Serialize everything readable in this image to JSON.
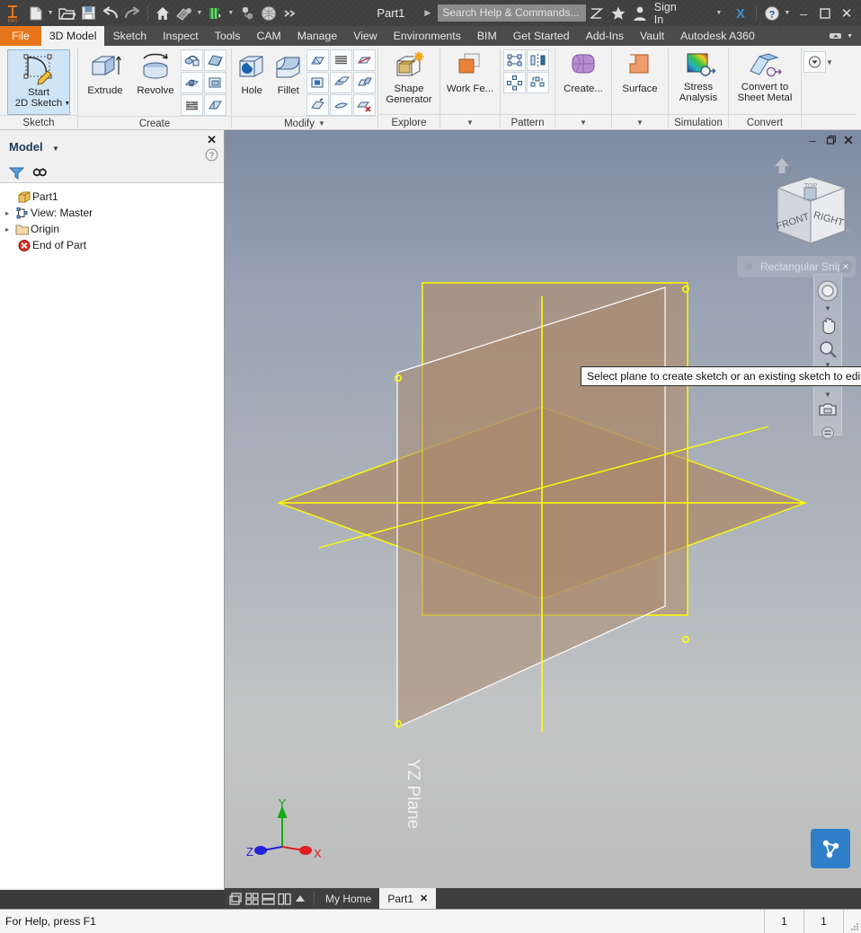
{
  "app": {
    "document_title": "Part1",
    "logo_text": "PRO"
  },
  "quick_access": {
    "items": [
      {
        "name": "new-file-icon",
        "label": "New"
      },
      {
        "name": "open-file-icon",
        "label": "Open"
      },
      {
        "name": "save-icon",
        "label": "Save"
      },
      {
        "name": "undo-icon",
        "label": "Undo"
      },
      {
        "name": "redo-icon",
        "label": "Redo"
      },
      {
        "name": "home-icon",
        "label": "Home"
      },
      {
        "name": "appearance-icon",
        "label": "Appearance"
      },
      {
        "name": "material-icon",
        "label": "Material"
      },
      {
        "name": "select-icon",
        "label": "Select"
      },
      {
        "name": "project-icon",
        "label": "Project"
      },
      {
        "name": "more-icon",
        "label": "More"
      }
    ]
  },
  "search": {
    "placeholder": "Search Help & Commands...",
    "value": ""
  },
  "account": {
    "sign_in_label": "Sign In"
  },
  "window_controls": {
    "minimize": "–",
    "maximize": "❐",
    "close": "✕"
  },
  "menu_tabs": [
    {
      "label": "File",
      "state": "file"
    },
    {
      "label": "3D Model",
      "state": "active"
    },
    {
      "label": "Sketch",
      "state": "normal"
    },
    {
      "label": "Inspect",
      "state": "normal"
    },
    {
      "label": "Tools",
      "state": "normal"
    },
    {
      "label": "CAM",
      "state": "normal"
    },
    {
      "label": "Manage",
      "state": "normal"
    },
    {
      "label": "View",
      "state": "normal"
    },
    {
      "label": "Environments",
      "state": "normal"
    },
    {
      "label": "BIM",
      "state": "normal"
    },
    {
      "label": "Get Started",
      "state": "normal"
    },
    {
      "label": "Add-Ins",
      "state": "normal"
    },
    {
      "label": "Vault",
      "state": "normal"
    },
    {
      "label": "Autodesk A360",
      "state": "normal"
    }
  ],
  "ribbon": {
    "panels": [
      {
        "label": "Sketch",
        "has_dropdown": false
      },
      {
        "label": "Create",
        "has_dropdown": false
      },
      {
        "label": "Modify",
        "has_dropdown": true
      },
      {
        "label": "Explore",
        "has_dropdown": false
      },
      {
        "label": "",
        "has_dropdown": true
      },
      {
        "label": "Pattern",
        "has_dropdown": false
      },
      {
        "label": "",
        "has_dropdown": true
      },
      {
        "label": "",
        "has_dropdown": true
      },
      {
        "label": "Simulation",
        "has_dropdown": false
      },
      {
        "label": "Convert",
        "has_dropdown": false
      }
    ],
    "sketch": {
      "start_2d_sketch_line1": "Start",
      "start_2d_sketch_line2": "2D Sketch"
    },
    "create": {
      "extrude_label": "Extrude",
      "revolve_label": "Revolve",
      "small_tools": [
        "sweep-icon",
        "loft-icon",
        "emboss-icon",
        "rib-icon",
        "derive-icon",
        "decal-icon",
        "coil-icon",
        "import-icon"
      ]
    },
    "modify": {
      "hole_label": "Hole",
      "fillet_label": "Fillet",
      "small_tools": [
        "chamfer-icon",
        "thread-icon",
        "shell-icon",
        "draft-icon",
        "direct-icon",
        "combine-icon",
        "split-icon",
        "thicken-offset-icon",
        "delete-face-icon"
      ]
    },
    "explore": {
      "shape_generator_line1": "Shape",
      "shape_generator_line2": "Generator"
    },
    "work_features": {
      "work_feature_label": "Work Fe..."
    },
    "pattern": {
      "small_tools": [
        "rectangular-pattern-icon",
        "mirror-icon",
        "circular-pattern-icon",
        "sketch-driven-pattern-icon"
      ]
    },
    "plastic": {
      "create_label": "Create..."
    },
    "surface": {
      "surface_label": "Surface"
    },
    "simulation": {
      "stress_line1": "Stress",
      "stress_line2": "Analysis"
    },
    "convert": {
      "convert_line1": "Convert to",
      "convert_line2": "Sheet Metal"
    }
  },
  "browser": {
    "title": "Model",
    "close_label": "✕",
    "help_label": "?",
    "tools": [
      {
        "name": "filter-icon",
        "label": "Filter"
      },
      {
        "name": "find-icon",
        "label": "Find"
      }
    ],
    "tree": [
      {
        "label": "Part1",
        "icon": "part-icon",
        "arrow": "",
        "indent": 0
      },
      {
        "label": "View: Master",
        "icon": "view-icon",
        "arrow": "▸",
        "indent": 0
      },
      {
        "label": "Origin",
        "icon": "folder-icon",
        "arrow": "▸",
        "indent": 0
      },
      {
        "label": "End of Part",
        "icon": "end-of-part-icon",
        "arrow": "",
        "indent": 0
      }
    ]
  },
  "viewport": {
    "tooltip_text": "Select plane to create sketch or an existing sketch to edit",
    "plane_label": "YZ Plane",
    "snip_widget": {
      "label": "Rectangular Snip",
      "close": "✕"
    },
    "view_cube": {
      "front_label": "FRONT",
      "right_label": "RIGHT",
      "top_label": "TOP"
    },
    "axis_triad": {
      "x_label": "X",
      "y_label": "Y",
      "z_label": "Z",
      "x_color": "#dd2020",
      "y_color": "#11aa11",
      "z_color": "#2222dd"
    },
    "navigation_bar": [
      {
        "name": "steering-wheel-icon",
        "label": "Full Navigation Wheel"
      },
      {
        "name": "pan-hand-icon",
        "label": "Pan"
      },
      {
        "name": "zoom-icon",
        "label": "Zoom"
      },
      {
        "name": "orbit-icon",
        "label": "Orbit"
      },
      {
        "name": "look-at-icon",
        "label": "Look At"
      }
    ],
    "window_controls": {
      "minimize": "–",
      "restore": "❐",
      "close": "✕"
    },
    "colors": {
      "plane_fill": "#ac8b6e",
      "plane_edge": "#ffff00",
      "axis_line": "#ffffff"
    }
  },
  "document_bar": {
    "layout_icons": [
      {
        "name": "cascade-windows-icon"
      },
      {
        "name": "tile-windows-icon"
      },
      {
        "name": "tile-horizontal-icon"
      },
      {
        "name": "tile-vertical-icon"
      },
      {
        "name": "expand-icon"
      }
    ],
    "tabs": [
      {
        "label": "My Home",
        "active": false,
        "closable": false
      },
      {
        "label": "Part1",
        "active": true,
        "closable": true,
        "close": "✕"
      }
    ]
  },
  "status_bar": {
    "message": "For Help, press F1",
    "cell_1": "1",
    "cell_2": "1"
  }
}
